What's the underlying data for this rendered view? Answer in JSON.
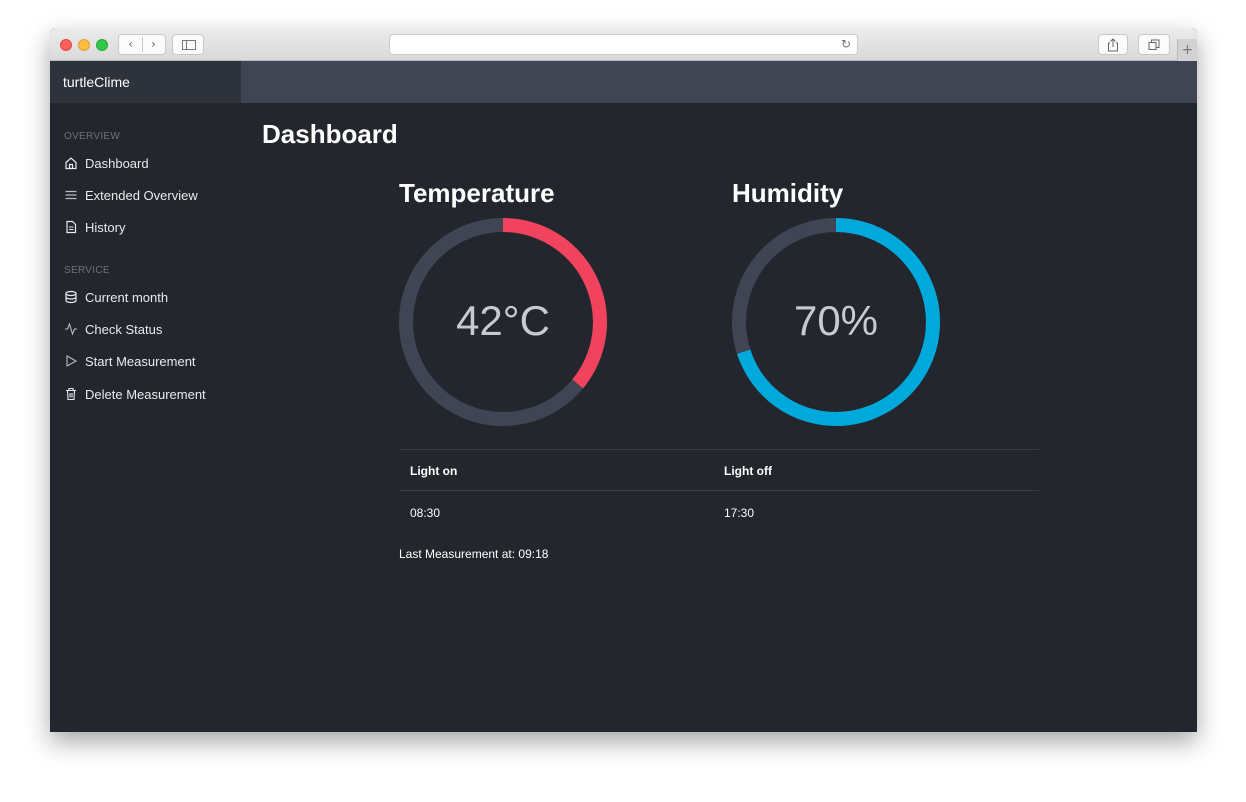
{
  "app": {
    "name": "turtleClime"
  },
  "sidebar": {
    "sections": [
      {
        "label": "OVERVIEW",
        "items": [
          {
            "label": "Dashboard",
            "icon": "home-icon"
          },
          {
            "label": "Extended Overview",
            "icon": "list-icon"
          },
          {
            "label": "History",
            "icon": "document-icon"
          }
        ]
      },
      {
        "label": "SERVICE",
        "items": [
          {
            "label": "Current month",
            "icon": "database-icon"
          },
          {
            "label": "Check Status",
            "icon": "activity-icon"
          },
          {
            "label": "Start Measurement",
            "icon": "play-icon"
          },
          {
            "label": "Delete Measurement",
            "icon": "trash-icon"
          }
        ]
      }
    ]
  },
  "page": {
    "title": "Dashboard"
  },
  "gauges": {
    "temperature": {
      "title": "Temperature",
      "display": "42°C",
      "fraction": 0.36,
      "color": "#f2435e",
      "track": "#3f4553"
    },
    "humidity": {
      "title": "Humidity",
      "display": "70%",
      "fraction": 0.7,
      "color": "#00a9dc",
      "track": "#3f4553"
    }
  },
  "lights": {
    "headers": [
      "Light on",
      "Light off"
    ],
    "values": [
      "08:30",
      "17:30"
    ]
  },
  "last_measurement": "Last Measurement at: 09:18",
  "browser": {
    "back_icon": "chevron-left-icon",
    "forward_icon": "chevron-right-icon",
    "reload_icon": "reload-icon"
  }
}
